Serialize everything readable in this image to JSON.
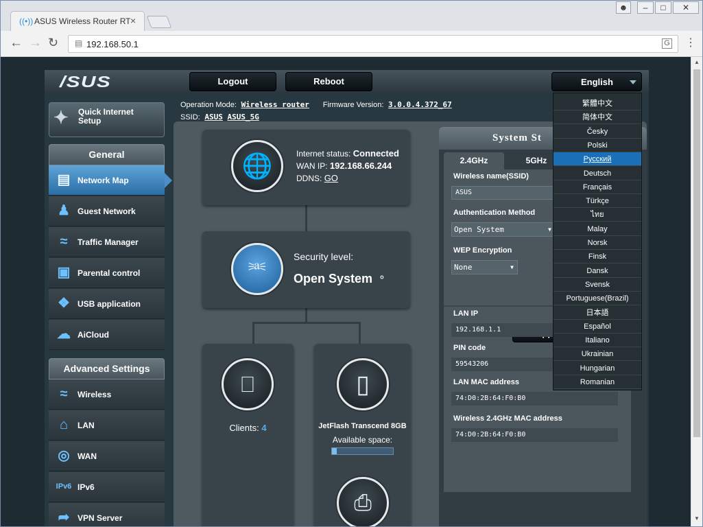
{
  "browser": {
    "tab_title": "ASUS Wireless Router RT",
    "url": "192.168.50.1"
  },
  "router": {
    "logo": "/SUS",
    "top": {
      "logout": "Logout",
      "reboot": "Reboot",
      "language": "English"
    },
    "op_mode_label": "Operation Mode:",
    "op_mode": "Wireless router",
    "fw_label": "Firmware Version:",
    "fw": "3.0.0.4.372_67",
    "ssid_label": "SSID:",
    "ssid1": "ASUS",
    "ssid2": "ASUS_5G",
    "quick_setup": "Quick Internet Setup",
    "general": "General",
    "advanced": "Advanced Settings",
    "general_items": [
      {
        "label": "Network Map",
        "icon": "network-map-icon"
      },
      {
        "label": "Guest Network",
        "icon": "guest-network-icon"
      },
      {
        "label": "Traffic Manager",
        "icon": "traffic-manager-icon"
      },
      {
        "label": "Parental control",
        "icon": "lock-icon"
      },
      {
        "label": "USB application",
        "icon": "puzzle-icon"
      },
      {
        "label": "AiCloud",
        "icon": "cloud-icon"
      }
    ],
    "advanced_items": [
      {
        "label": "Wireless",
        "icon": "wifi-icon"
      },
      {
        "label": "LAN",
        "icon": "home-icon"
      },
      {
        "label": "WAN",
        "icon": "globe-icon"
      },
      {
        "label": "IPv6",
        "icon": "ipv6-icon"
      },
      {
        "label": "VPN Server",
        "icon": "vpn-icon"
      }
    ],
    "internet": {
      "status_label": "Internet status:",
      "status": "Connected",
      "wan_label": "WAN IP:",
      "wan_ip": "192.168.66.244",
      "ddns_label": "DDNS:",
      "ddns": "GO"
    },
    "security": {
      "label": "Security level:",
      "value": "Open System"
    },
    "clients": {
      "label": "Clients:",
      "count": "4"
    },
    "usb": {
      "device": "JetFlash Transcend 8GB",
      "space_label": "Available space:",
      "fill_fraction": 0.08
    },
    "status_panel": {
      "title": "System St",
      "tab_24": "2.4GHz",
      "tab_5": "5GHz",
      "ssid_label": "Wireless name(SSID)",
      "ssid_value": "ASUS",
      "auth_label": "Authentication Method",
      "auth_value": "Open System",
      "wep_label": "WEP Encryption",
      "wep_value": "None",
      "apply": "Appl",
      "lan_ip_label": "LAN IP",
      "lan_ip": "192.168.1.1",
      "pin_label": "PIN code",
      "pin": "59543206",
      "lan_mac_label": "LAN MAC address",
      "lan_mac": "74:D0:2B:64:F0:B0",
      "wl_mac_label": "Wireless 2.4GHz MAC address",
      "wl_mac": "74:D0:2B:64:F0:B0"
    },
    "languages": [
      "繁體中文",
      "简体中文",
      "Česky",
      "Polski",
      "Русский",
      "Deutsch",
      "Français",
      "Türkçe",
      "ไทย",
      "Malay",
      "Norsk",
      "Finsk",
      "Dansk",
      "Svensk",
      "Portuguese(Brazil)",
      "日本語",
      "Español",
      "Italiano",
      "Ukrainian",
      "Hungarian",
      "Romanian"
    ],
    "selected_language": "Русский"
  }
}
